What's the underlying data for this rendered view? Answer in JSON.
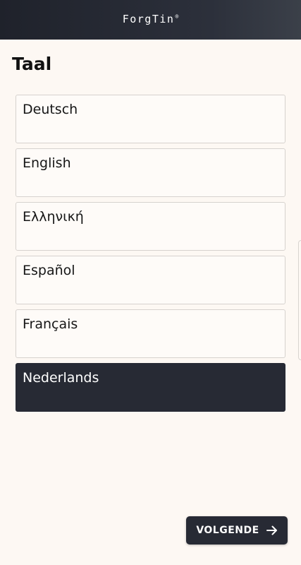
{
  "app": {
    "logo_text": "ForgTin",
    "logo_mark": "®"
  },
  "page": {
    "title": "Taal"
  },
  "languages": [
    {
      "label": "Deutsch",
      "selected": false
    },
    {
      "label": "English",
      "selected": false
    },
    {
      "label": "Ελληνική",
      "selected": false
    },
    {
      "label": "Español",
      "selected": false
    },
    {
      "label": "Français",
      "selected": false
    },
    {
      "label": "Nederlands",
      "selected": true
    }
  ],
  "footer": {
    "next_label": "VOLGENDE",
    "next_icon": "arrow-right-icon"
  },
  "colors": {
    "background": "#fdf8f3",
    "header": "#272a34",
    "selected": "#272a34",
    "border": "#d6d2ce"
  }
}
